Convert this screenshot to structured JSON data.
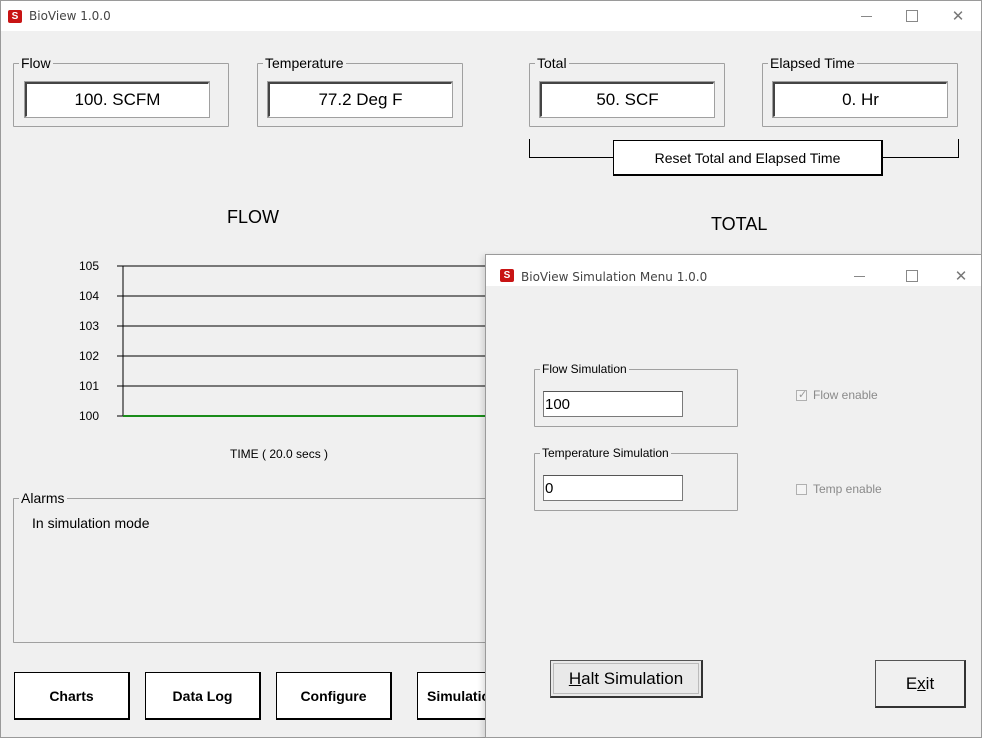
{
  "main_window": {
    "title": "BioView 1.0.0",
    "flow": {
      "label": "Flow",
      "value": "100. SCFM"
    },
    "temperature": {
      "label": "Temperature",
      "value": "77.2 Deg F"
    },
    "total": {
      "label": "Total",
      "value": "50. SCF"
    },
    "elapsed": {
      "label": "Elapsed Time",
      "value": "0.  Hr"
    },
    "reset_button": "Reset Total and Elapsed Time",
    "flow_chart_title": "FLOW",
    "total_chart_title": "TOTAL",
    "time_label": "TIME ( 20.0 secs )",
    "alarms": {
      "label": "Alarms",
      "message": "In simulation mode"
    },
    "buttons": {
      "charts": "Charts",
      "data_log": "Data Log",
      "configure": "Configure",
      "simulation": "Simulation"
    }
  },
  "chart_data": {
    "type": "line",
    "title": "FLOW",
    "xlabel": "TIME ( 20.0 secs )",
    "ylabel": "",
    "ylim": [
      100,
      105
    ],
    "yticks": [
      "105",
      "104",
      "103",
      "102",
      "101",
      "100"
    ],
    "grid": true,
    "series": [
      {
        "values": [
          100,
          100
        ]
      }
    ],
    "series_color": "#1a8c1a"
  },
  "sim_window": {
    "title": "BioView Simulation Menu 1.0.0",
    "flow_sim": {
      "label": "Flow Simulation",
      "value": "100"
    },
    "temp_sim": {
      "label": "Temperature Simulation",
      "value": "0"
    },
    "flow_enable": {
      "label": "Flow enable",
      "checked": true
    },
    "temp_enable": {
      "label": "Temp enable",
      "checked": false
    },
    "halt_button": {
      "prefix": "H",
      "rest": "alt Simulation"
    },
    "exit_button": {
      "prefix": "E",
      "mid": "x",
      "rest": "it"
    }
  },
  "icons": {
    "app": "app-logo-icon",
    "minimize": "minimize-icon",
    "maximize": "maximize-icon",
    "close": "close-icon"
  }
}
